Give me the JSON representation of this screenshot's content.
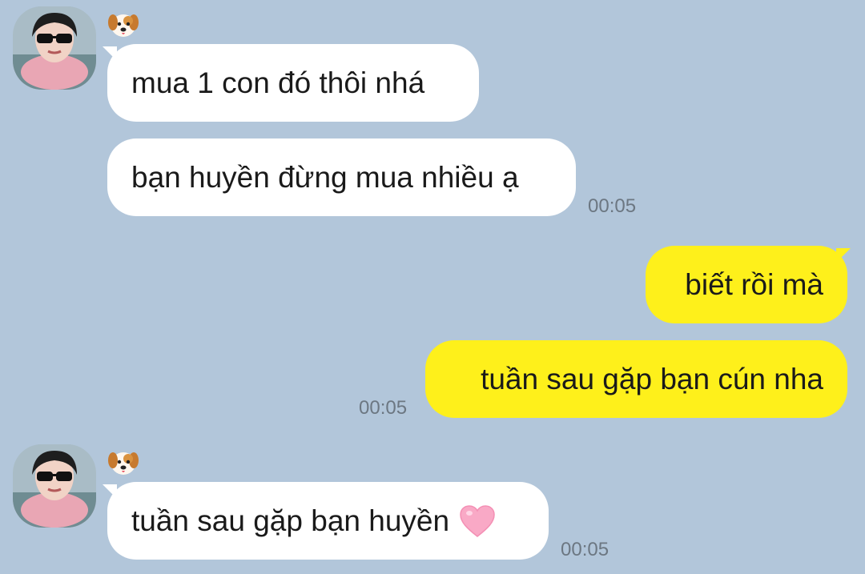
{
  "colors": {
    "background": "#b2c6da",
    "incoming_bubble": "#ffffff",
    "outgoing_bubble": "#fef01b",
    "timestamp": "#6c7782"
  },
  "groups": [
    {
      "direction": "incoming",
      "sender_icon": "puppy-emoji-icon",
      "messages": [
        {
          "text": "mua 1 con đó thôi nhá"
        },
        {
          "text": "bạn huyền đừng mua nhiều ạ",
          "time": "00:05"
        }
      ]
    },
    {
      "direction": "outgoing",
      "messages": [
        {
          "text": "biết rồi mà"
        },
        {
          "text": "tuần sau gặp bạn cún nha",
          "time": "00:05"
        }
      ]
    },
    {
      "direction": "incoming",
      "sender_icon": "puppy-emoji-icon",
      "messages": [
        {
          "text": "tuần sau gặp bạn huyền",
          "emoji": "pink-heart-icon",
          "time": "00:05"
        }
      ]
    }
  ]
}
